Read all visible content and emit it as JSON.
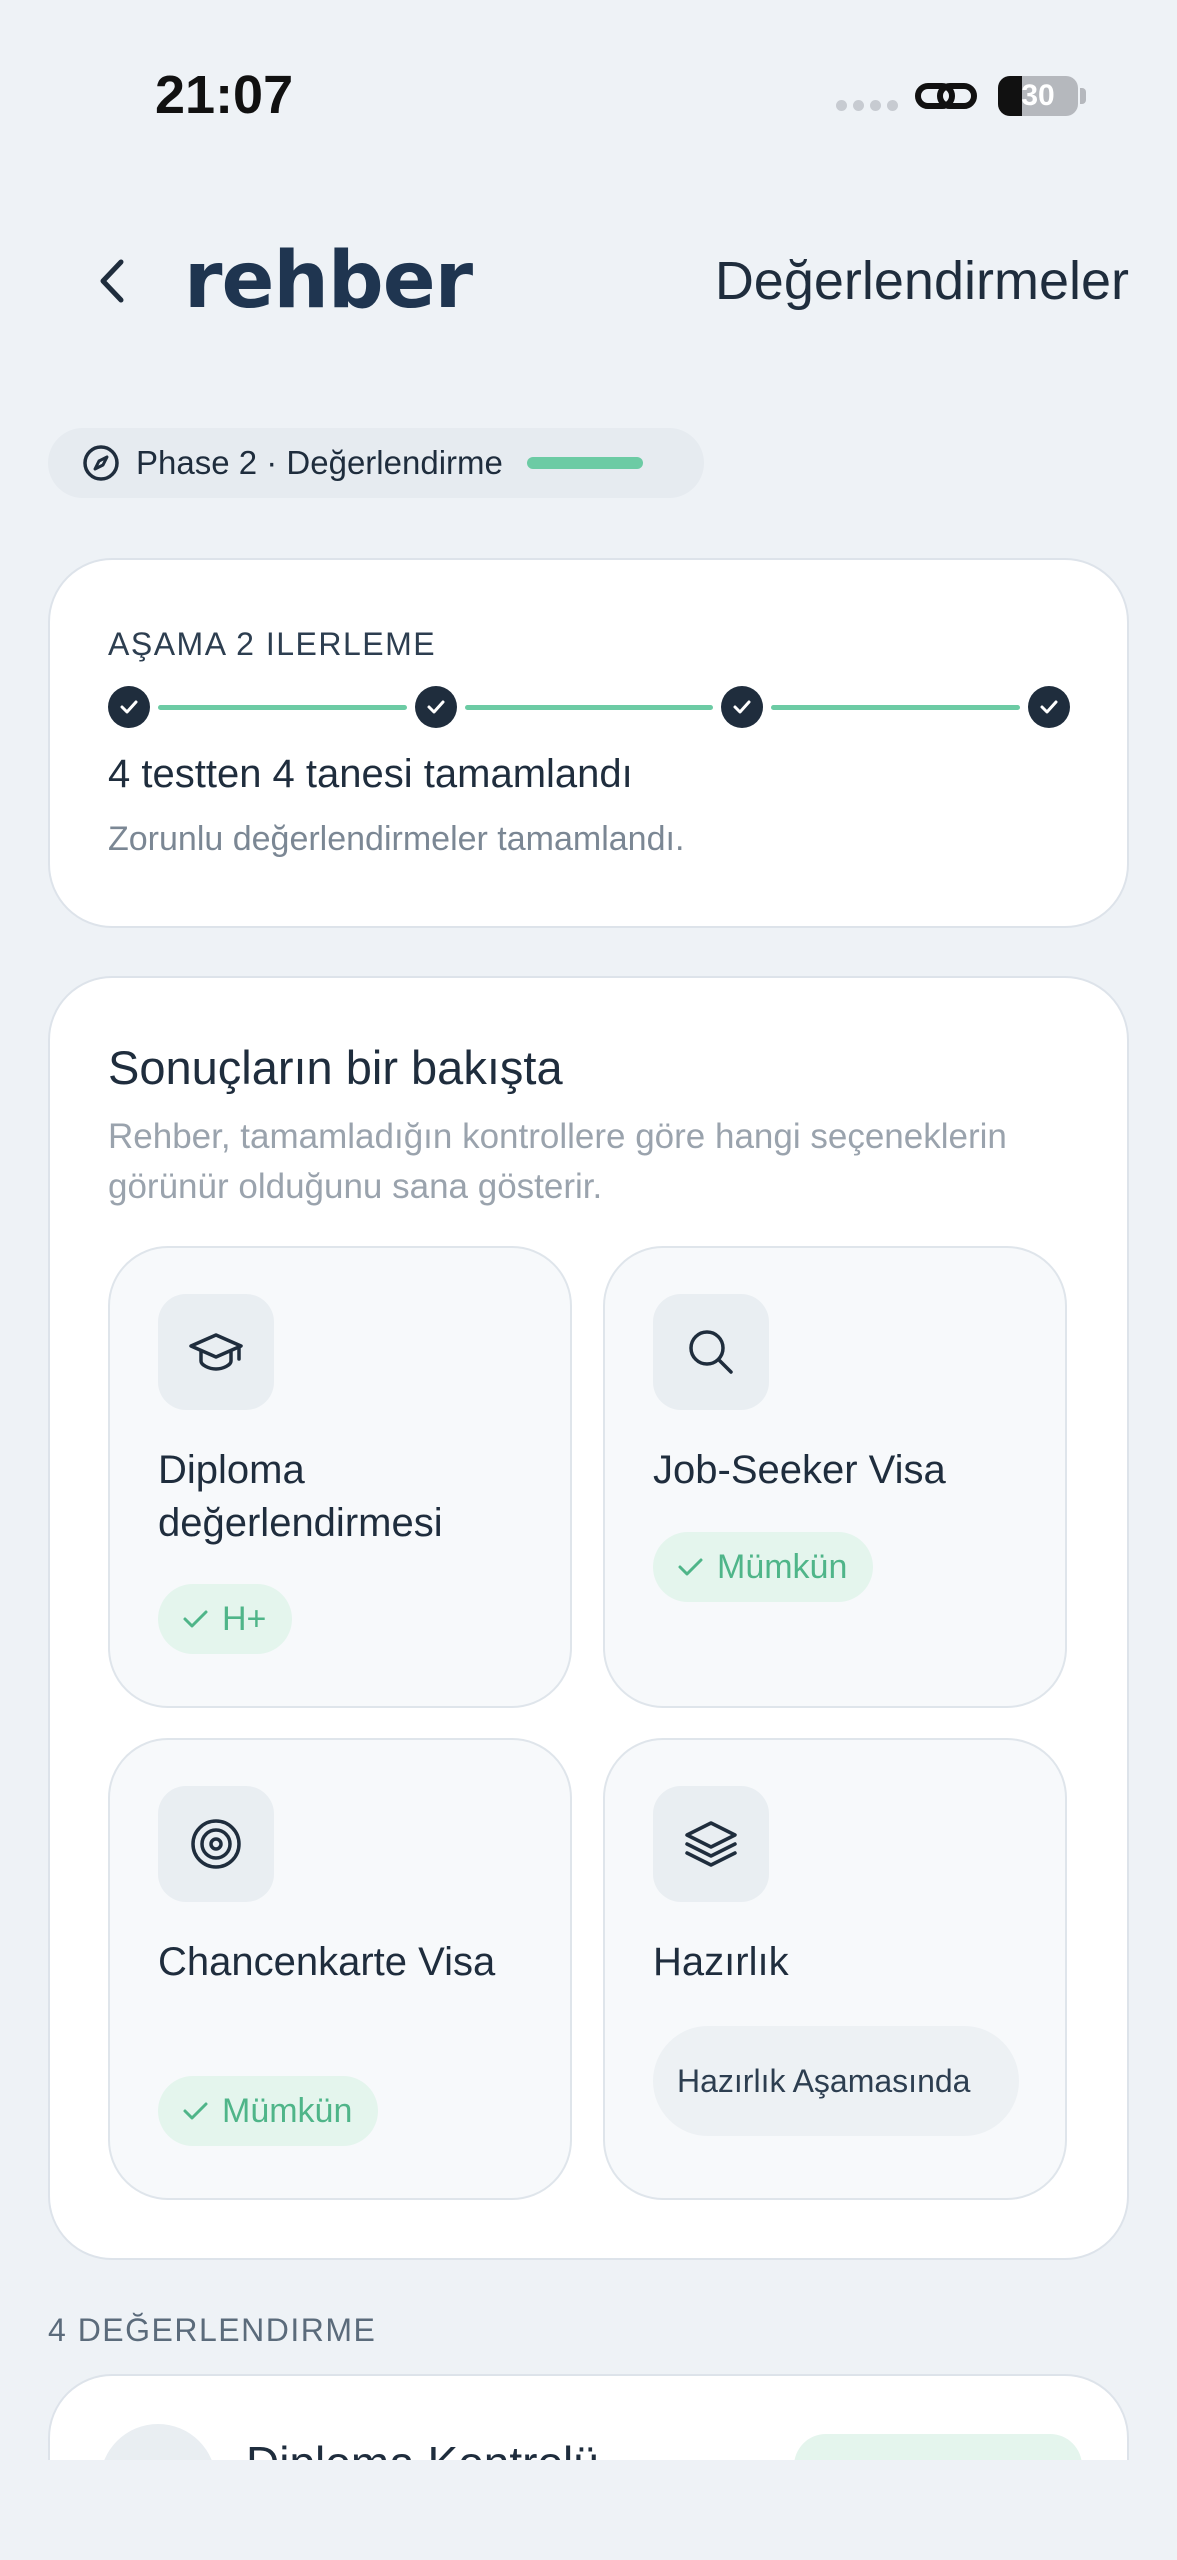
{
  "status_bar": {
    "time": "21:07",
    "battery": "30"
  },
  "header": {
    "logo": "rehber",
    "title": "Değerlendirmeler"
  },
  "phase_chip": {
    "label": "Phase 2 · Değerlendirme",
    "progress": 1.0
  },
  "progress_card": {
    "label": "AŞAMA 2 ILERLEME",
    "steps_completed": 4,
    "steps_total": 4,
    "main_text": "4 testten 4 tanesi tamamlandı",
    "sub_text": "Zorunlu değerlendirmeler tamamlandı."
  },
  "results": {
    "title": "Sonuçların bir bakışta",
    "description": "Rehber, tamamladığın kontrollere göre hangi seçeneklerin görünür olduğunu sana gösterir.",
    "tiles": [
      {
        "icon": "graduation-cap-icon",
        "title": "Diploma değerlendirmesi",
        "badge": "H+",
        "badge_type": "success"
      },
      {
        "icon": "search-icon",
        "title": "Job-Seeker Visa",
        "badge": "Mümkün",
        "badge_type": "success"
      },
      {
        "icon": "target-icon",
        "title": "Chancenkarte Visa",
        "badge": "Mümkün",
        "badge_type": "success"
      },
      {
        "icon": "layers-icon",
        "title": "Hazırlık",
        "badge": "Hazırlık Aşamasında",
        "badge_type": "neutral"
      }
    ]
  },
  "assessments": {
    "section_label": "4 DEĞERLENDIRME",
    "items": [
      {
        "title": "Diploma Kontrolü"
      }
    ]
  },
  "colors": {
    "background": "#eef2f6",
    "accent_green": "#6ccba4",
    "success_text": "#4fb589",
    "dark": "#1f2d3d"
  }
}
